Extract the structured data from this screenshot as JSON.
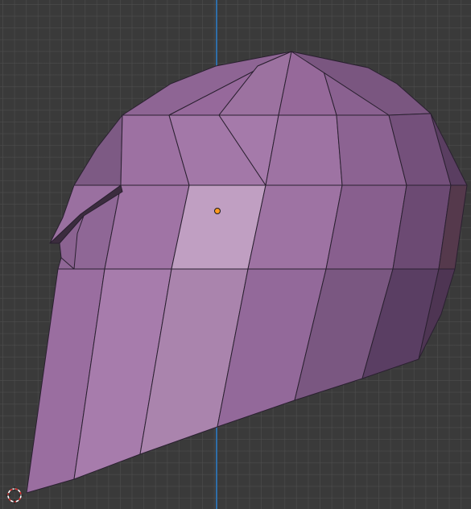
{
  "viewport": {
    "background_color": "#3a3a3a",
    "grid_color": "#505050",
    "y_axis_color": "#2f6ea8"
  },
  "mesh": {
    "base_color": "#a276a6",
    "highlight_face_color": "#c09fc2",
    "edge_color": "#2a2030"
  },
  "origin": {
    "color": "#ff9a1f"
  },
  "cursor_3d": {
    "colors": [
      "#e03030",
      "#ffffff"
    ]
  }
}
